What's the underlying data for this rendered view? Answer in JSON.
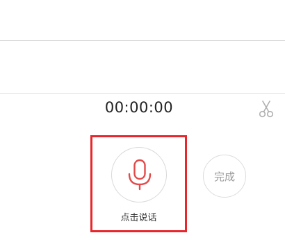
{
  "recorder": {
    "timer": "00:00:00",
    "mic_label": "点击说话",
    "done_label": "完成"
  },
  "icons": {
    "mic": "microphone-icon",
    "scissors": "scissors-icon"
  },
  "colors": {
    "accent": "#e8262b",
    "mic": "#e34a4a",
    "muted_text": "#9a9a9a"
  }
}
